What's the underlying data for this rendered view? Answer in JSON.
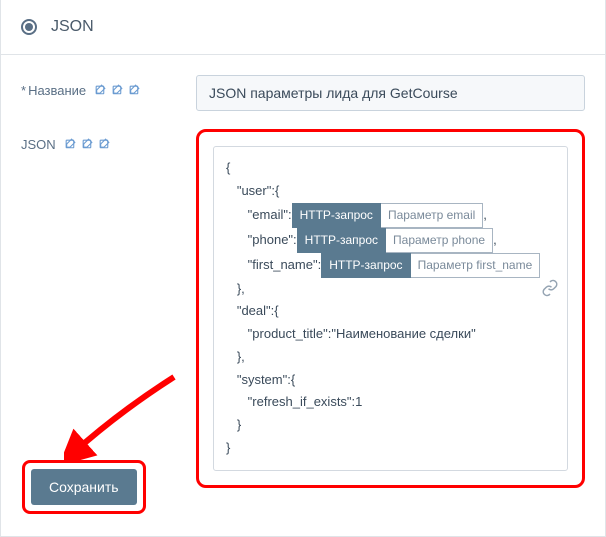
{
  "header": {
    "title": "JSON"
  },
  "formName": {
    "required_mark": "*",
    "label": "Название",
    "value": "JSON параметры лида для GetCourse"
  },
  "json": {
    "label": "JSON",
    "lines": {
      "open": "{",
      "user_open": "   \"user\":{",
      "email_key": "      \"email\":",
      "phone_key": "      \"phone\":",
      "fn_key": "      \"first_name\":",
      "user_close": "   },",
      "deal_open": "   \"deal\":{",
      "deal_line": "      \"product_title\":\"Наименование сделки\"",
      "deal_close": "   },",
      "sys_open": "   \"system\":{",
      "sys_line": "      \"refresh_if_exists\":1",
      "sys_close": "   }",
      "close": "}"
    },
    "tags": {
      "http": "HTTP-запрос",
      "param_email": "Параметр email",
      "param_phone": "Параметр phone",
      "param_fn": "Параметр first_name"
    },
    "comma": ","
  },
  "buttons": {
    "save": "Сохранить"
  }
}
